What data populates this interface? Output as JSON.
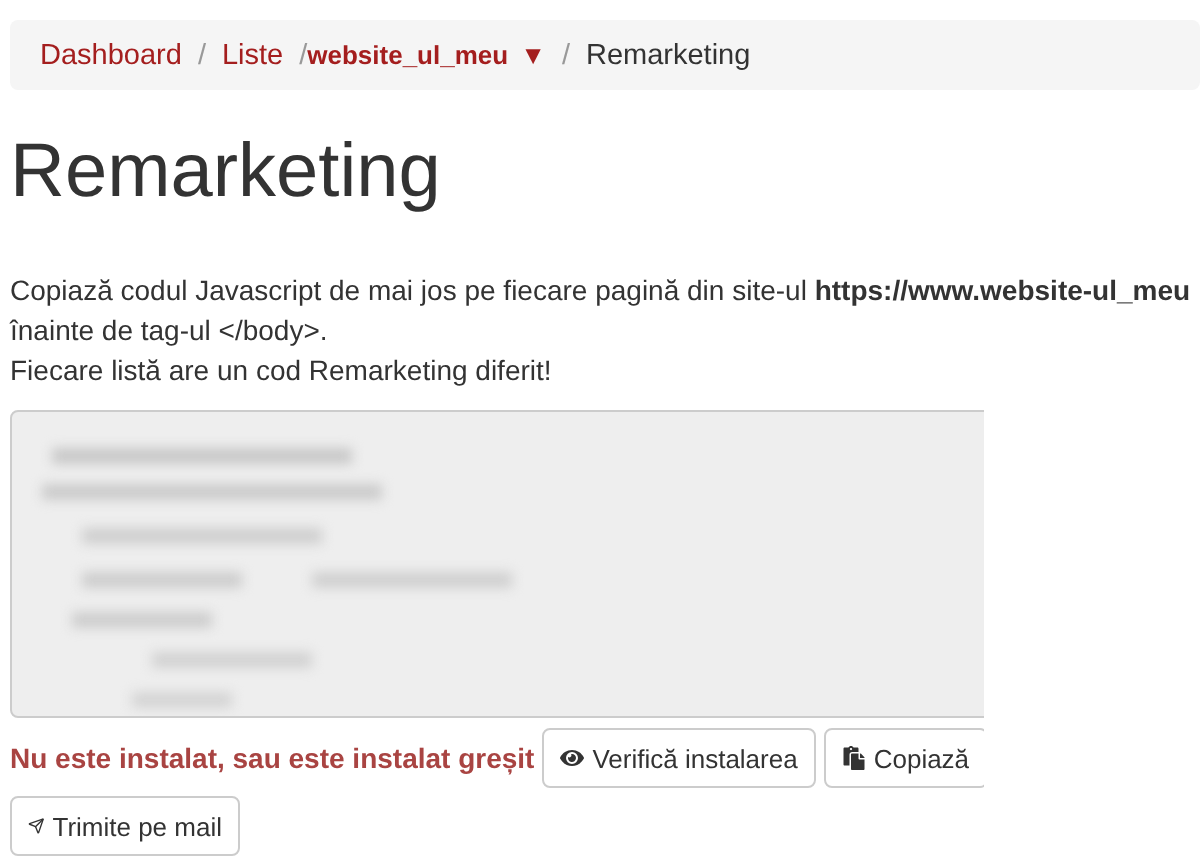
{
  "breadcrumb": [
    {
      "label": "Dashboard",
      "kind": "link"
    },
    {
      "label": "Liste",
      "kind": "link",
      "separator": "/"
    },
    {
      "label": "website_ul_meu",
      "kind": "dropdown",
      "caret": "▼",
      "separator": "/"
    },
    {
      "label": "Remarketing",
      "kind": "current",
      "separator": "/"
    }
  ],
  "title": "Remarketing",
  "instructions": [
    "Copiază codul Javascript de mai jos pe fiecare pagină din site-ul **https://www.website-ul_meu**",
    "înainte de tag-ul </body>.",
    "Fiecare listă are un cod Remarketing diferit!"
  ],
  "code_box": {
    "kind": "picture"
  },
  "status": "Nu este instalat, sau este instalat greșit",
  "buttons": [
    {
      "label": "Verifică instalarea"
    },
    {
      "label": "Copiază"
    },
    {
      "label": "Trimite pe mail"
    }
  ]
}
